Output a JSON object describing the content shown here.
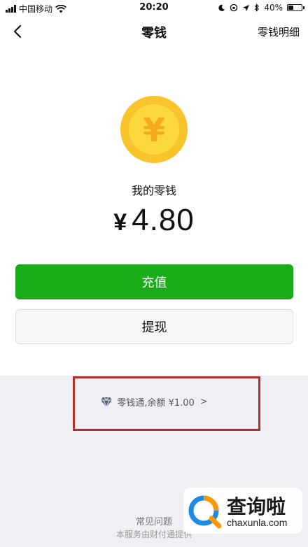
{
  "status_bar": {
    "carrier": "中国移动",
    "time": "20:20",
    "battery_percent": "40%",
    "battery_level": 0.4
  },
  "nav": {
    "title": "零钱",
    "right_label": "零钱明细"
  },
  "wallet": {
    "coin_symbol": "¥",
    "balance_label": "我的零钱",
    "currency": "¥",
    "amount": "4.80"
  },
  "actions": {
    "recharge_label": "充值",
    "withdraw_label": "提现"
  },
  "lingqiantong": {
    "text": "零钱通,余额 ¥1.00",
    "chevron": ">"
  },
  "footer": {
    "faq_label": "常见问题",
    "service_text": "本服务由财付通提供"
  },
  "watermark": {
    "title": "查询啦",
    "subtitle": "chaxunla.com"
  },
  "colors": {
    "primary_green": "#1aad19",
    "coin_yellow": "#f7c52b",
    "highlight_red": "#b0302a",
    "gray_bg": "#efeff4"
  }
}
